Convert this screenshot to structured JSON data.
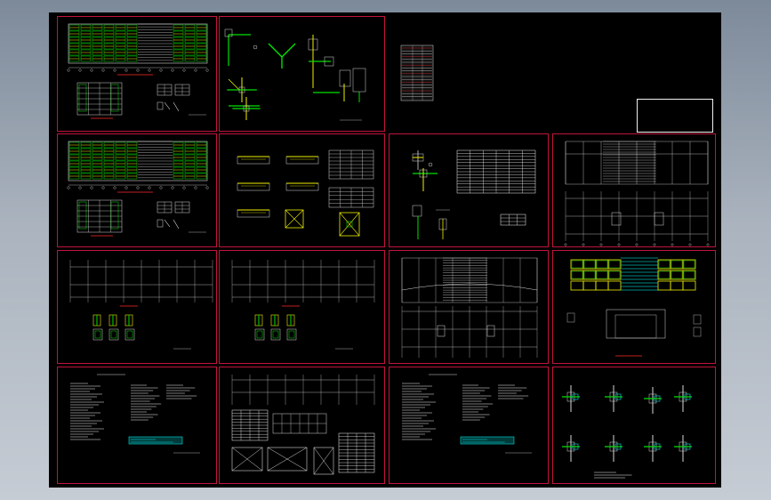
{
  "viewport": {
    "background_top": "#7d8a9a",
    "background_bottom": "#c6ccd4",
    "canvas": "#000000"
  },
  "colors": {
    "frame": "#c0143c",
    "line": "#d8d8d8",
    "yellow": "#f0f000",
    "green": "#00e000",
    "cyan": "#00e0e0",
    "red": "#ff2a2a",
    "white": "#f4f4f4"
  },
  "title_block": {
    "line1": "",
    "line2": "",
    "line3": "",
    "line4": ""
  },
  "sheets": [
    {
      "id": "s1",
      "kind": "elevation-plan"
    },
    {
      "id": "s2",
      "kind": "node-details"
    },
    {
      "id": "s3",
      "kind": "material-table"
    },
    {
      "id": "s4",
      "kind": "elevation-plan"
    },
    {
      "id": "s5",
      "kind": "beam-details"
    },
    {
      "id": "s6",
      "kind": "column-details"
    },
    {
      "id": "s7",
      "kind": "grid-plan"
    },
    {
      "id": "s8",
      "kind": "grid-plan-small"
    },
    {
      "id": "s9",
      "kind": "grid-plan-small"
    },
    {
      "id": "s10",
      "kind": "roof-plan"
    },
    {
      "id": "s11",
      "kind": "yellow-roof"
    },
    {
      "id": "s12",
      "kind": "notes"
    },
    {
      "id": "s13",
      "kind": "grid-table"
    },
    {
      "id": "s14",
      "kind": "notes"
    },
    {
      "id": "s15",
      "kind": "connection-details"
    }
  ]
}
